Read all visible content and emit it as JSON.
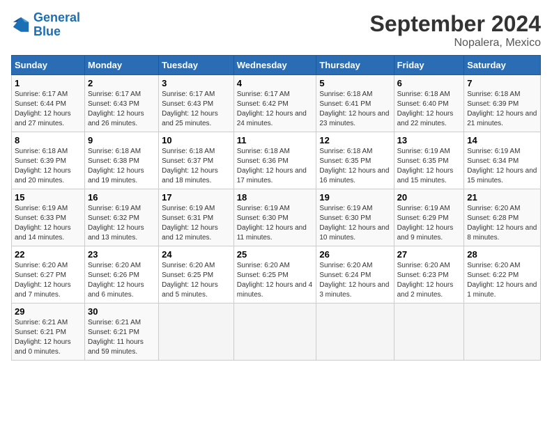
{
  "logo": {
    "line1": "General",
    "line2": "Blue"
  },
  "title": "September 2024",
  "subtitle": "Nopalera, Mexico",
  "headers": [
    "Sunday",
    "Monday",
    "Tuesday",
    "Wednesday",
    "Thursday",
    "Friday",
    "Saturday"
  ],
  "weeks": [
    [
      {
        "day": "1",
        "sunrise": "6:17 AM",
        "sunset": "6:44 PM",
        "daylight": "12 hours and 27 minutes."
      },
      {
        "day": "2",
        "sunrise": "6:17 AM",
        "sunset": "6:43 PM",
        "daylight": "12 hours and 26 minutes."
      },
      {
        "day": "3",
        "sunrise": "6:17 AM",
        "sunset": "6:43 PM",
        "daylight": "12 hours and 25 minutes."
      },
      {
        "day": "4",
        "sunrise": "6:17 AM",
        "sunset": "6:42 PM",
        "daylight": "12 hours and 24 minutes."
      },
      {
        "day": "5",
        "sunrise": "6:18 AM",
        "sunset": "6:41 PM",
        "daylight": "12 hours and 23 minutes."
      },
      {
        "day": "6",
        "sunrise": "6:18 AM",
        "sunset": "6:40 PM",
        "daylight": "12 hours and 22 minutes."
      },
      {
        "day": "7",
        "sunrise": "6:18 AM",
        "sunset": "6:39 PM",
        "daylight": "12 hours and 21 minutes."
      }
    ],
    [
      {
        "day": "8",
        "sunrise": "6:18 AM",
        "sunset": "6:39 PM",
        "daylight": "12 hours and 20 minutes."
      },
      {
        "day": "9",
        "sunrise": "6:18 AM",
        "sunset": "6:38 PM",
        "daylight": "12 hours and 19 minutes."
      },
      {
        "day": "10",
        "sunrise": "6:18 AM",
        "sunset": "6:37 PM",
        "daylight": "12 hours and 18 minutes."
      },
      {
        "day": "11",
        "sunrise": "6:18 AM",
        "sunset": "6:36 PM",
        "daylight": "12 hours and 17 minutes."
      },
      {
        "day": "12",
        "sunrise": "6:18 AM",
        "sunset": "6:35 PM",
        "daylight": "12 hours and 16 minutes."
      },
      {
        "day": "13",
        "sunrise": "6:19 AM",
        "sunset": "6:35 PM",
        "daylight": "12 hours and 15 minutes."
      },
      {
        "day": "14",
        "sunrise": "6:19 AM",
        "sunset": "6:34 PM",
        "daylight": "12 hours and 15 minutes."
      }
    ],
    [
      {
        "day": "15",
        "sunrise": "6:19 AM",
        "sunset": "6:33 PM",
        "daylight": "12 hours and 14 minutes."
      },
      {
        "day": "16",
        "sunrise": "6:19 AM",
        "sunset": "6:32 PM",
        "daylight": "12 hours and 13 minutes."
      },
      {
        "day": "17",
        "sunrise": "6:19 AM",
        "sunset": "6:31 PM",
        "daylight": "12 hours and 12 minutes."
      },
      {
        "day": "18",
        "sunrise": "6:19 AM",
        "sunset": "6:30 PM",
        "daylight": "12 hours and 11 minutes."
      },
      {
        "day": "19",
        "sunrise": "6:19 AM",
        "sunset": "6:30 PM",
        "daylight": "12 hours and 10 minutes."
      },
      {
        "day": "20",
        "sunrise": "6:19 AM",
        "sunset": "6:29 PM",
        "daylight": "12 hours and 9 minutes."
      },
      {
        "day": "21",
        "sunrise": "6:20 AM",
        "sunset": "6:28 PM",
        "daylight": "12 hours and 8 minutes."
      }
    ],
    [
      {
        "day": "22",
        "sunrise": "6:20 AM",
        "sunset": "6:27 PM",
        "daylight": "12 hours and 7 minutes."
      },
      {
        "day": "23",
        "sunrise": "6:20 AM",
        "sunset": "6:26 PM",
        "daylight": "12 hours and 6 minutes."
      },
      {
        "day": "24",
        "sunrise": "6:20 AM",
        "sunset": "6:25 PM",
        "daylight": "12 hours and 5 minutes."
      },
      {
        "day": "25",
        "sunrise": "6:20 AM",
        "sunset": "6:25 PM",
        "daylight": "12 hours and 4 minutes."
      },
      {
        "day": "26",
        "sunrise": "6:20 AM",
        "sunset": "6:24 PM",
        "daylight": "12 hours and 3 minutes."
      },
      {
        "day": "27",
        "sunrise": "6:20 AM",
        "sunset": "6:23 PM",
        "daylight": "12 hours and 2 minutes."
      },
      {
        "day": "28",
        "sunrise": "6:20 AM",
        "sunset": "6:22 PM",
        "daylight": "12 hours and 1 minute."
      }
    ],
    [
      {
        "day": "29",
        "sunrise": "6:21 AM",
        "sunset": "6:21 PM",
        "daylight": "12 hours and 0 minutes."
      },
      {
        "day": "30",
        "sunrise": "6:21 AM",
        "sunset": "6:21 PM",
        "daylight": "11 hours and 59 minutes."
      },
      null,
      null,
      null,
      null,
      null
    ]
  ]
}
